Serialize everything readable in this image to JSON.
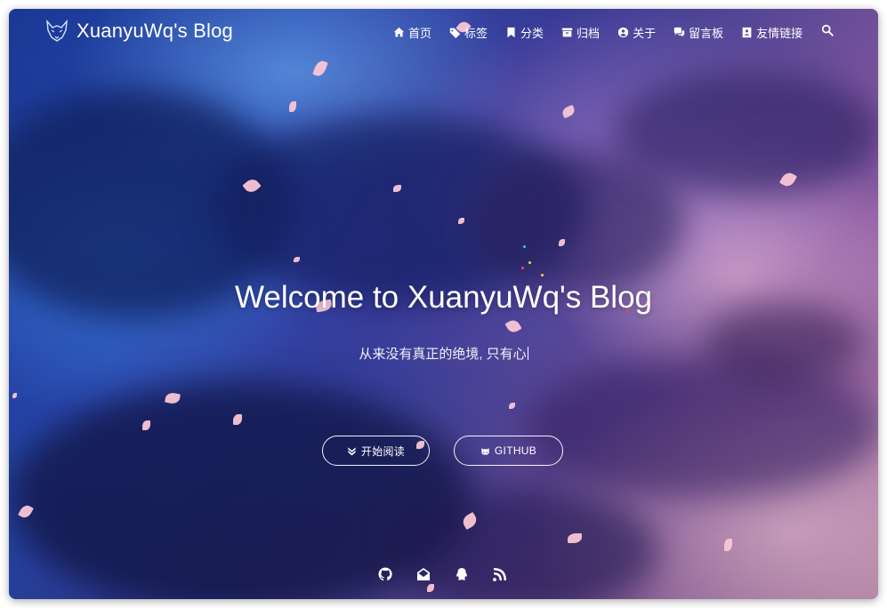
{
  "header": {
    "title": "XuanyuWq's Blog",
    "nav": [
      {
        "label": "首页",
        "icon": "home-icon"
      },
      {
        "label": "标签",
        "icon": "tags-icon"
      },
      {
        "label": "分类",
        "icon": "bookmark-icon"
      },
      {
        "label": "归档",
        "icon": "archive-icon"
      },
      {
        "label": "关于",
        "icon": "user-circle-icon"
      },
      {
        "label": "留言板",
        "icon": "comments-icon"
      },
      {
        "label": "友情链接",
        "icon": "address-book-icon"
      }
    ],
    "search_icon": "search-icon"
  },
  "hero": {
    "title": "Welcome to XuanyuWq's Blog",
    "subtitle": "从来没有真正的绝境, 只有心",
    "buttons": {
      "read_label": "开始阅读",
      "github_label": "GITHUB"
    }
  },
  "social": [
    "github-icon",
    "mail-icon",
    "qq-icon",
    "rss-icon"
  ],
  "colors": {
    "text": "#ffffff",
    "petal": "#f9c6d4",
    "sky_blue": "#2a4bb8",
    "sky_purple": "#8a5aa3"
  }
}
